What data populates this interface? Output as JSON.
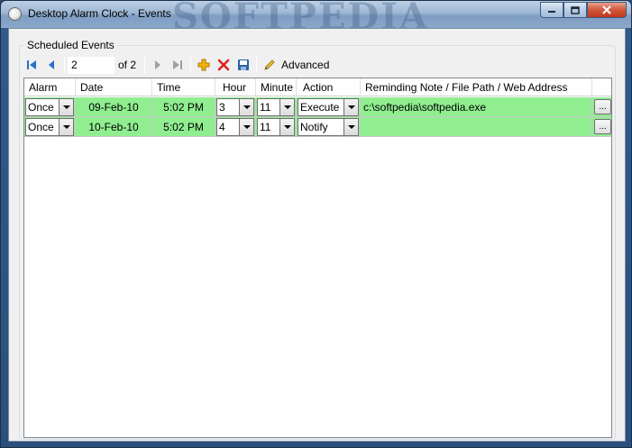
{
  "window": {
    "title": "Desktop Alarm Clock - Events",
    "watermark": "SOFTPEDIA"
  },
  "group": {
    "label": "Scheduled Events"
  },
  "toolbar": {
    "position_value": "2",
    "of_label": "of 2",
    "advanced_label": "Advanced"
  },
  "columns": [
    "Alarm",
    "Date",
    "Time",
    "Hour",
    "Minute",
    "Action",
    "Reminding Note / File Path / Web Address"
  ],
  "rows": [
    {
      "alarm": "Once",
      "date": "09-Feb-10",
      "time": "5:02 PM",
      "hour": "3",
      "minute": "11",
      "action": "Execute",
      "note": "c:\\softpedia\\softpedia.exe",
      "button": "..."
    },
    {
      "alarm": "Once",
      "date": "10-Feb-10",
      "time": "5:02 PM",
      "hour": "4",
      "minute": "11",
      "action": "Notify",
      "note": "",
      "button": "..."
    }
  ],
  "colors": {
    "row_highlight": "#90ee90",
    "nav_icon": "#2a6fc9",
    "add_icon": "#e8a000",
    "delete_icon": "#e02020"
  }
}
